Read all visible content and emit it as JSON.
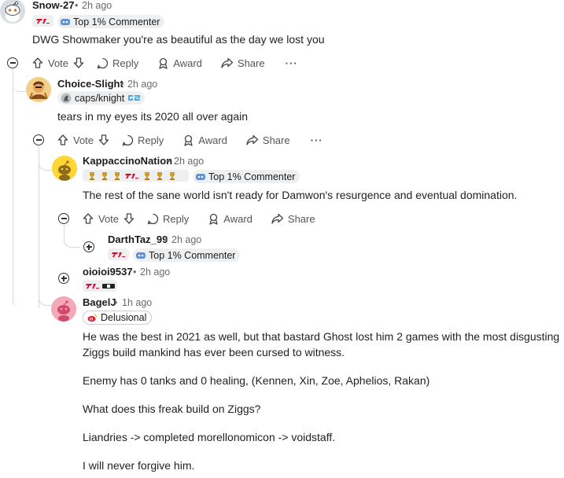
{
  "comments": [
    {
      "username": "Snow-27",
      "time": "2h ago",
      "flair": "Top 1% Commenter",
      "body": [
        "DWG Showmaker you're as beautiful as the day we lost you"
      ]
    },
    {
      "username": "Choice-Slight",
      "time": "2h ago",
      "flair": "caps/knight",
      "body": [
        "tears in my eyes its 2020 all over again"
      ]
    },
    {
      "username": "KappaccinoNation",
      "time": "2h ago",
      "flair": "Top 1% Commenter",
      "body": [
        "The rest of the sane world isn't ready for Damwon's resurgence and eventual domination."
      ]
    },
    {
      "username": "DarthTaz_99",
      "time": "2h ago",
      "flair": "Top 1% Commenter"
    },
    {
      "username": "oioioi9537",
      "time": "2h ago"
    },
    {
      "username": "BagelJ",
      "time": "1h ago",
      "flair": "Delusional",
      "body": [
        "He was the best in 2021 as well, but that bastard Ghost lost him 2 games with the most disgusting",
        "Ziggs build mankind has ever been cursed to witness.",
        "Enemy has 0 tanks and 0 healing, (Kennen, Xin, Zoe, Aphelios, Rakan)",
        "What does this freak build on Ziggs?",
        "Liandries -> completed morellonomicon -> voidstaff.",
        "I will never forgive him."
      ]
    }
  ],
  "separator": "•",
  "actions": {
    "vote": "Vote",
    "reply": "Reply",
    "award": "Award",
    "share": "Share",
    "more": "···"
  },
  "colors": {
    "thread_line": "#d6d9dc",
    "flair_bg": "#edeff1",
    "text": "#1a1a1b",
    "meta": "#6a6a6a"
  },
  "icons": [
    "upvote-icon",
    "downvote-icon",
    "reply-icon",
    "award-icon",
    "share-icon",
    "more-icon",
    "collapse-icon",
    "expand-icon"
  ]
}
